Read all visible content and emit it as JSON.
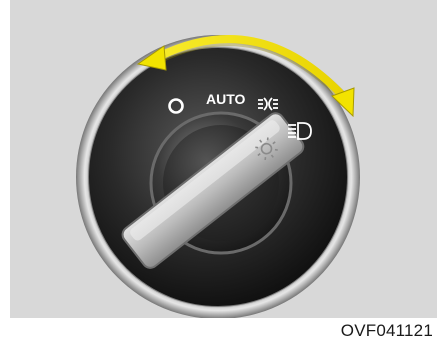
{
  "figure": {
    "code": "OVF041121"
  },
  "switch": {
    "positions": [
      {
        "label": "O",
        "icon": "off-ring-icon"
      },
      {
        "label": "AUTO",
        "icon": ""
      },
      {
        "label": "",
        "icon": "parking-lights-icon"
      },
      {
        "label": "",
        "icon": "headlight-icon"
      }
    ],
    "knob_icon": "sun-icon",
    "rotation_arrow": "double-headed-arrow"
  },
  "colors": {
    "background": "#d8d8d8",
    "arrow": "#f0e000",
    "bezel": "#2b2b2b",
    "knob": "#c8c8c8"
  }
}
